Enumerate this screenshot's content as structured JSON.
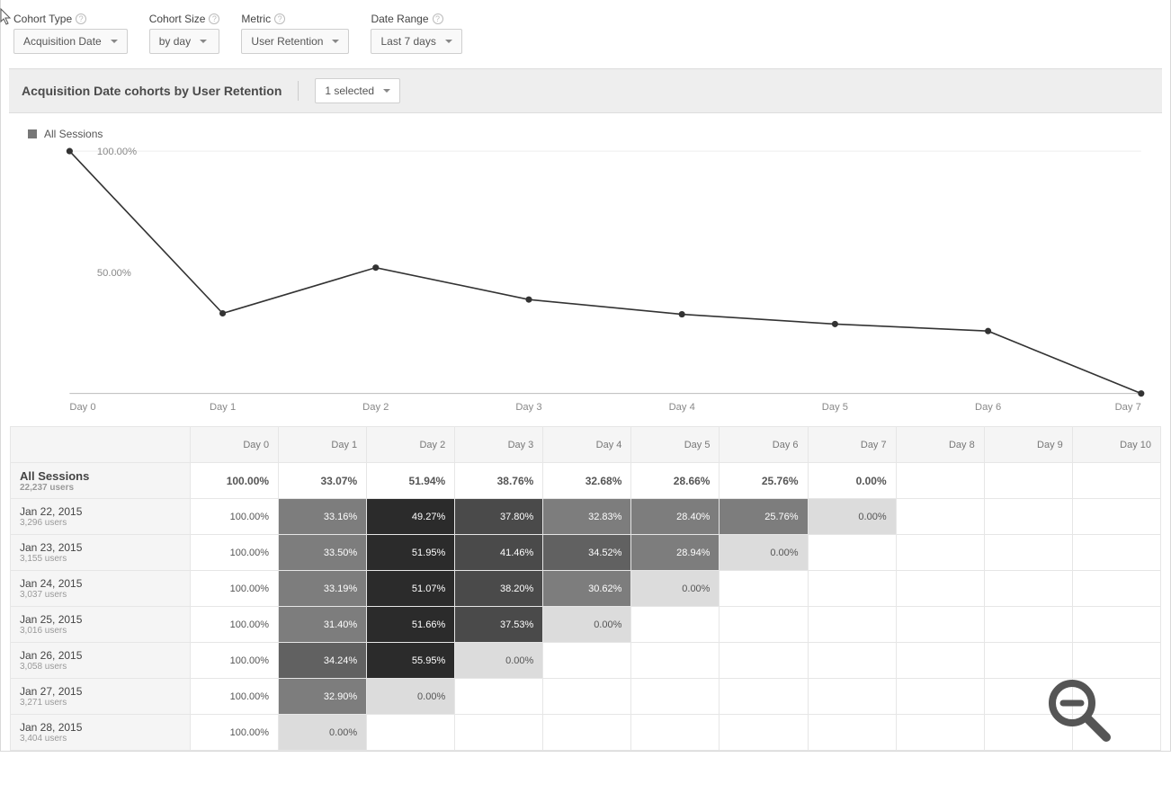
{
  "controls": {
    "cohort_type": {
      "label": "Cohort Type",
      "value": "Acquisition Date"
    },
    "cohort_size": {
      "label": "Cohort Size",
      "value": "by day"
    },
    "metric": {
      "label": "Metric",
      "value": "User Retention"
    },
    "date_range": {
      "label": "Date Range",
      "value": "Last 7 days"
    }
  },
  "chart_header": {
    "title": "Acquisition Date cohorts by User Retention",
    "selector": "1 selected"
  },
  "legend": {
    "series_name": "All Sessions"
  },
  "chart_data": {
    "type": "line",
    "categories": [
      "Day 0",
      "Day 1",
      "Day 2",
      "Day 3",
      "Day 4",
      "Day 5",
      "Day 6",
      "Day 7"
    ],
    "values": [
      100.0,
      33.07,
      51.94,
      38.76,
      32.68,
      28.66,
      25.76,
      0.0
    ],
    "ylabel": "",
    "xlabel": "",
    "ylim": [
      0,
      100
    ],
    "yticks": [
      50,
      100
    ],
    "ytick_labels": [
      "50.00%",
      "100.00%"
    ]
  },
  "table": {
    "headers": [
      "Day 0",
      "Day 1",
      "Day 2",
      "Day 3",
      "Day 4",
      "Day 5",
      "Day 6",
      "Day 7",
      "Day 8",
      "Day 9",
      "Day 10"
    ],
    "summary": {
      "name": "All Sessions",
      "sub": "22,237 users",
      "cells": [
        "100.00%",
        "33.07%",
        "51.94%",
        "38.76%",
        "32.68%",
        "28.66%",
        "25.76%",
        "0.00%",
        "",
        "",
        ""
      ]
    },
    "rows": [
      {
        "name": "Jan 22, 2015",
        "sub": "3,296 users",
        "cells": [
          "100.00%",
          "33.16%",
          "49.27%",
          "37.80%",
          "32.83%",
          "28.40%",
          "25.76%",
          "0.00%",
          "",
          "",
          ""
        ],
        "shade": [
          0,
          40,
          80,
          60,
          40,
          40,
          40,
          10,
          null,
          null,
          null
        ]
      },
      {
        "name": "Jan 23, 2015",
        "sub": "3,155 users",
        "cells": [
          "100.00%",
          "33.50%",
          "51.95%",
          "41.46%",
          "34.52%",
          "28.94%",
          "0.00%",
          "",
          "",
          "",
          ""
        ],
        "shade": [
          0,
          40,
          80,
          60,
          50,
          40,
          10,
          null,
          null,
          null,
          null
        ]
      },
      {
        "name": "Jan 24, 2015",
        "sub": "3,037 users",
        "cells": [
          "100.00%",
          "33.19%",
          "51.07%",
          "38.20%",
          "30.62%",
          "0.00%",
          "",
          "",
          "",
          "",
          ""
        ],
        "shade": [
          0,
          40,
          80,
          60,
          40,
          10,
          null,
          null,
          null,
          null,
          null
        ]
      },
      {
        "name": "Jan 25, 2015",
        "sub": "3,016 users",
        "cells": [
          "100.00%",
          "31.40%",
          "51.66%",
          "37.53%",
          "0.00%",
          "",
          "",
          "",
          "",
          "",
          ""
        ],
        "shade": [
          0,
          40,
          80,
          60,
          10,
          null,
          null,
          null,
          null,
          null,
          null
        ]
      },
      {
        "name": "Jan 26, 2015",
        "sub": "3,058 users",
        "cells": [
          "100.00%",
          "34.24%",
          "55.95%",
          "0.00%",
          "",
          "",
          "",
          "",
          "",
          "",
          ""
        ],
        "shade": [
          0,
          50,
          80,
          10,
          null,
          null,
          null,
          null,
          null,
          null,
          null
        ]
      },
      {
        "name": "Jan 27, 2015",
        "sub": "3,271 users",
        "cells": [
          "100.00%",
          "32.90%",
          "0.00%",
          "",
          "",
          "",
          "",
          "",
          "",
          "",
          ""
        ],
        "shade": [
          0,
          40,
          10,
          null,
          null,
          null,
          null,
          null,
          null,
          null,
          null
        ]
      },
      {
        "name": "Jan 28, 2015",
        "sub": "3,404 users",
        "cells": [
          "100.00%",
          "0.00%",
          "",
          "",
          "",
          "",
          "",
          "",
          "",
          "",
          ""
        ],
        "shade": [
          0,
          10,
          null,
          null,
          null,
          null,
          null,
          null,
          null,
          null,
          null
        ]
      }
    ]
  }
}
